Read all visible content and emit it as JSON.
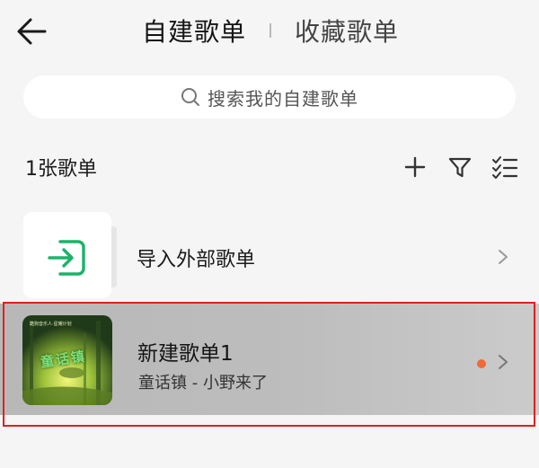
{
  "header": {
    "tabs": [
      {
        "label": "自建歌单",
        "active": true
      },
      {
        "label": "收藏歌单",
        "active": false
      }
    ]
  },
  "search": {
    "placeholder": "搜索我的自建歌单"
  },
  "toolbar": {
    "count_label": "1张歌单"
  },
  "import": {
    "label": "导入外部歌单"
  },
  "playlist": {
    "title": "新建歌单1",
    "subtitle": "童话镇 - 小野来了",
    "cover_text_top": "酷狗音乐人·星耀计划",
    "cover_text_main": "童话镇"
  },
  "colors": {
    "accent_green": "#1bb36a",
    "dot_orange": "#f06a3a",
    "highlight_red": "#e02020"
  },
  "icons": [
    "back-arrow-icon",
    "search-icon",
    "plus-icon",
    "filter-icon",
    "list-sort-icon",
    "import-icon",
    "chevron-right-icon"
  ]
}
